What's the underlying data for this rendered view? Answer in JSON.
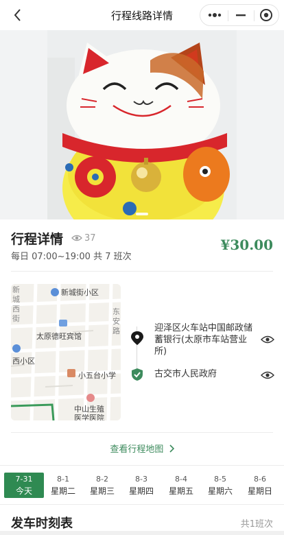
{
  "nav": {
    "title": "行程线路详情",
    "back_icon": "chevron-left-icon",
    "more_icon": "more-dots-icon",
    "minimize_icon": "minus-icon",
    "close_icon": "target-circle-icon"
  },
  "detail": {
    "title": "行程详情",
    "views": "37",
    "schedule": "每日 07:00~19:00 共 7 班次",
    "price": "¥30.00"
  },
  "map": {
    "labels": [
      "新城街小区",
      "太原德旺宾馆",
      "西小区",
      "小五台小学",
      "中山生殖",
      "医学医院",
      "新",
      "城",
      "西",
      "街",
      "东",
      "安",
      "路"
    ]
  },
  "stops": [
    {
      "name": "迎泽区火车站中国邮政储蓄银行(太原市车站营业所)",
      "icon": "location-pin-icon"
    },
    {
      "name": "古交市人民政府",
      "icon": "check-shield-icon"
    }
  ],
  "map_link": "查看行程地图",
  "dates": [
    {
      "date": "7-31",
      "week": "今天",
      "active": true
    },
    {
      "date": "8-1",
      "week": "星期二"
    },
    {
      "date": "8-2",
      "week": "星期三"
    },
    {
      "date": "8-3",
      "week": "星期四"
    },
    {
      "date": "8-4",
      "week": "星期五"
    },
    {
      "date": "8-5",
      "week": "星期六"
    },
    {
      "date": "8-6",
      "week": "星期日"
    }
  ],
  "timetable": {
    "title": "发车时刻表",
    "count": "共1班次"
  },
  "colors": {
    "accent": "#2f8a52",
    "price": "#3d8b5d"
  }
}
